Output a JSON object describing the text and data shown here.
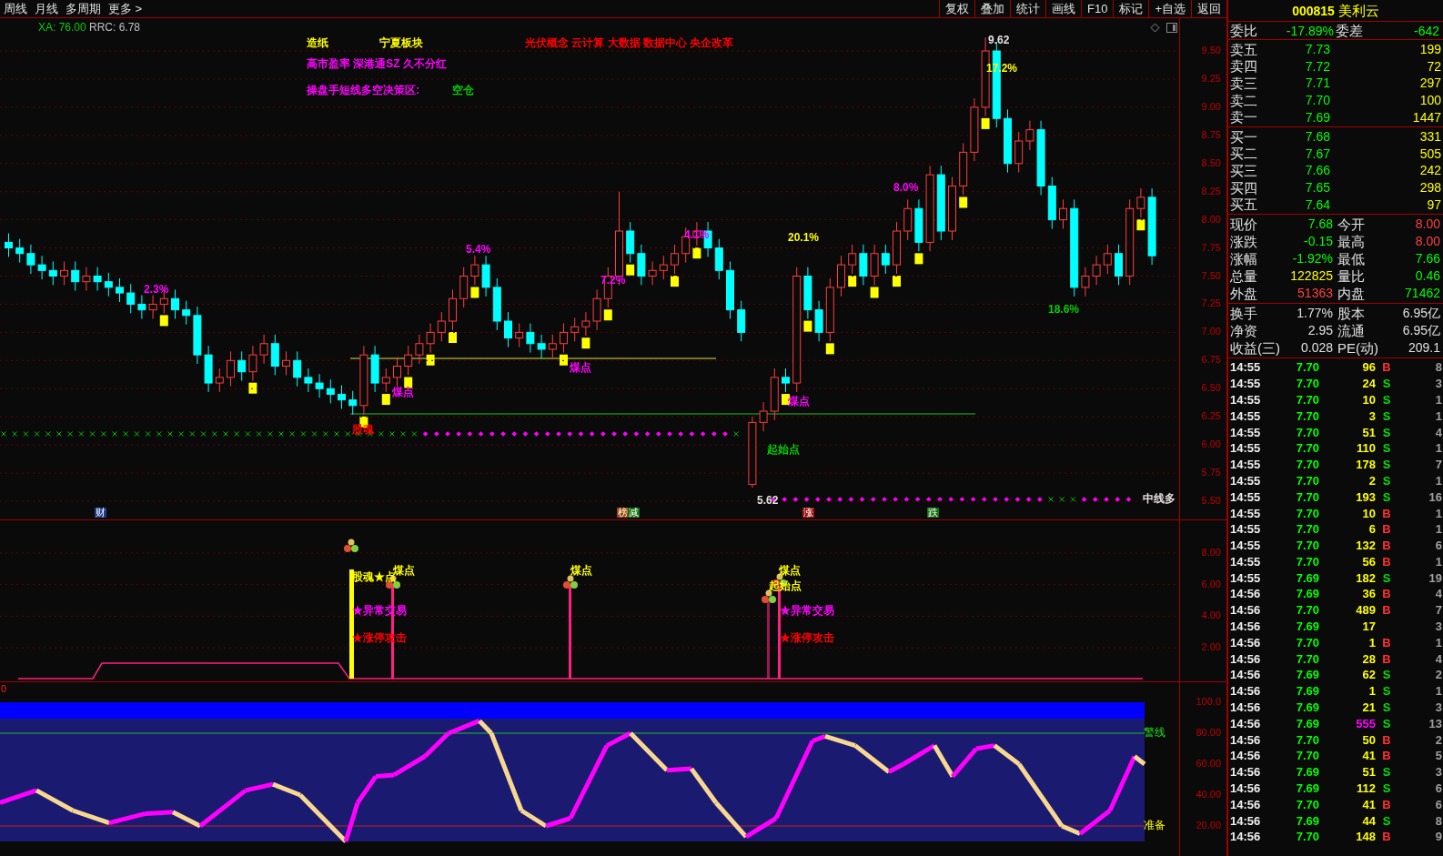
{
  "toolbar_left": [
    "周线",
    "月线",
    "多周期",
    "更多 >"
  ],
  "toolbar_right": [
    "复权",
    "叠加",
    "统计",
    "画线",
    "F10",
    "标记",
    "+自选",
    "返回"
  ],
  "main_chart": {
    "indicators": [
      {
        "text": "XA: 76.00",
        "color": "#00d000"
      },
      {
        "text": "RRC: 6.78",
        "color": "#c0c0c0"
      }
    ],
    "tags": [
      {
        "text": "造纸",
        "color": "#ffff00"
      },
      {
        "text": "宁夏板块",
        "color": "#ffff00"
      },
      {
        "text": "光伏概念 云计算 大数据 数据中心 央企改革",
        "color": "#ff0000"
      },
      {
        "text": "高市盈率 深港通SZ 久不分红",
        "color": "#ff00ff"
      },
      {
        "text": "操盘手短线多空决策区:",
        "color": "#ff00ff"
      },
      {
        "text": "空仓",
        "color": "#00d000"
      }
    ],
    "annotations": [
      {
        "text": "2.3%",
        "color": "#ff00ff"
      },
      {
        "text": "5.4%",
        "color": "#ff00ff"
      },
      {
        "text": "7.2%",
        "color": "#ff00ff"
      },
      {
        "text": "4.1%",
        "color": "#ff00ff"
      },
      {
        "text": "20.1%",
        "color": "#ffff00"
      },
      {
        "text": "8.0%",
        "color": "#ff00ff"
      },
      {
        "text": "17.2%",
        "color": "#ffff00"
      },
      {
        "text": "18.6%",
        "color": "#00d000"
      },
      {
        "text": "9.62",
        "color": "#e0e0e0"
      },
      {
        "text": "煤点",
        "color": "#ff00ff"
      },
      {
        "text": "煤点",
        "color": "#ff00ff"
      },
      {
        "text": "煤点",
        "color": "#ff00ff"
      },
      {
        "text": "起始点",
        "color": "#00d000"
      },
      {
        "text": "股魂",
        "color": "#ff0000"
      },
      {
        "text": "中线多",
        "color": "#e0e0e0"
      },
      {
        "text": "5.62",
        "color": "#e0e0e0"
      }
    ],
    "markers": [
      {
        "text": "财",
        "color": "#1a3a8a"
      },
      {
        "text": "榜",
        "color": "#a04000"
      },
      {
        "text": "减",
        "color": "#107010"
      },
      {
        "text": "涨",
        "color": "#a01010"
      },
      {
        "text": "跌",
        "color": "#107010"
      }
    ],
    "chart_data": {
      "type": "candlestick",
      "ohlc": [
        [
          7.8,
          7.88,
          7.67,
          7.75
        ],
        [
          7.75,
          7.83,
          7.62,
          7.7
        ],
        [
          7.7,
          7.78,
          7.52,
          7.6
        ],
        [
          7.6,
          7.68,
          7.47,
          7.55
        ],
        [
          7.55,
          7.63,
          7.42,
          7.5
        ],
        [
          7.5,
          7.63,
          7.42,
          7.55
        ],
        [
          7.55,
          7.63,
          7.37,
          7.45
        ],
        [
          7.45,
          7.58,
          7.37,
          7.5
        ],
        [
          7.5,
          7.58,
          7.37,
          7.45
        ],
        [
          7.45,
          7.53,
          7.32,
          7.4
        ],
        [
          7.4,
          7.48,
          7.27,
          7.35
        ],
        [
          7.35,
          7.43,
          7.17,
          7.25
        ],
        [
          7.25,
          7.33,
          7.12,
          7.2
        ],
        [
          7.2,
          7.33,
          7.12,
          7.25
        ],
        [
          7.25,
          7.38,
          7.17,
          7.3
        ],
        [
          7.3,
          7.38,
          7.12,
          7.2
        ],
        [
          7.2,
          7.28,
          7.07,
          7.15
        ],
        [
          7.15,
          7.23,
          6.72,
          6.8
        ],
        [
          6.8,
          6.88,
          6.47,
          6.55
        ],
        [
          6.55,
          6.68,
          6.47,
          6.6
        ],
        [
          6.6,
          6.83,
          6.52,
          6.75
        ],
        [
          6.75,
          6.83,
          6.57,
          6.65
        ],
        [
          6.65,
          6.88,
          6.57,
          6.8
        ],
        [
          6.8,
          6.98,
          6.72,
          6.9
        ],
        [
          6.9,
          6.98,
          6.62,
          6.7
        ],
        [
          6.7,
          6.83,
          6.62,
          6.75
        ],
        [
          6.75,
          6.83,
          6.52,
          6.6
        ],
        [
          6.6,
          6.68,
          6.47,
          6.55
        ],
        [
          6.55,
          6.63,
          6.42,
          6.5
        ],
        [
          6.5,
          6.58,
          6.37,
          6.45
        ],
        [
          6.45,
          6.53,
          6.32,
          6.4
        ],
        [
          6.4,
          6.48,
          6.27,
          6.35
        ],
        [
          6.35,
          6.88,
          6.27,
          6.8
        ],
        [
          6.8,
          6.88,
          6.47,
          6.55
        ],
        [
          6.55,
          6.68,
          6.47,
          6.6
        ],
        [
          6.6,
          6.78,
          6.52,
          6.7
        ],
        [
          6.7,
          6.88,
          6.62,
          6.8
        ],
        [
          6.8,
          6.98,
          6.72,
          6.9
        ],
        [
          6.9,
          7.08,
          6.82,
          7.0
        ],
        [
          7.0,
          7.18,
          6.92,
          7.1
        ],
        [
          7.1,
          7.38,
          7.02,
          7.3
        ],
        [
          7.3,
          7.58,
          7.22,
          7.5
        ],
        [
          7.5,
          7.68,
          7.42,
          7.6
        ],
        [
          7.6,
          7.68,
          7.32,
          7.4
        ],
        [
          7.4,
          7.48,
          7.02,
          7.1
        ],
        [
          7.1,
          7.18,
          6.87,
          6.95
        ],
        [
          6.95,
          7.08,
          6.87,
          7.0
        ],
        [
          7.0,
          7.08,
          6.82,
          6.9
        ],
        [
          6.9,
          6.98,
          6.77,
          6.85
        ],
        [
          6.85,
          6.98,
          6.77,
          6.9
        ],
        [
          6.9,
          7.08,
          6.82,
          7.0
        ],
        [
          7.0,
          7.13,
          6.92,
          7.05
        ],
        [
          7.05,
          7.18,
          6.97,
          7.1
        ],
        [
          7.1,
          7.38,
          7.02,
          7.3
        ],
        [
          7.3,
          7.58,
          7.22,
          7.5
        ],
        [
          7.5,
          8.25,
          7.42,
          7.9
        ],
        [
          7.9,
          7.98,
          7.62,
          7.7
        ],
        [
          7.7,
          7.78,
          7.42,
          7.5
        ],
        [
          7.5,
          7.63,
          7.42,
          7.55
        ],
        [
          7.55,
          7.68,
          7.47,
          7.6
        ],
        [
          7.6,
          7.78,
          7.52,
          7.7
        ],
        [
          7.7,
          7.93,
          7.62,
          7.85
        ],
        [
          7.85,
          7.98,
          7.77,
          7.9
        ],
        [
          7.9,
          7.98,
          7.67,
          7.75
        ],
        [
          7.75,
          7.83,
          7.47,
          7.55
        ],
        [
          7.55,
          7.63,
          7.12,
          7.2
        ],
        [
          7.2,
          7.28,
          6.92,
          7.0
        ],
        [
          5.65,
          6.25,
          5.62,
          6.2
        ],
        [
          6.2,
          6.38,
          6.12,
          6.3
        ],
        [
          6.3,
          6.68,
          6.22,
          6.6
        ],
        [
          6.6,
          6.68,
          6.47,
          6.55
        ],
        [
          6.55,
          7.58,
          6.47,
          7.5
        ],
        [
          7.5,
          7.58,
          7.12,
          7.2
        ],
        [
          7.2,
          7.28,
          6.92,
          7.0
        ],
        [
          7.0,
          7.48,
          6.92,
          7.4
        ],
        [
          7.4,
          7.68,
          7.32,
          7.6
        ],
        [
          7.6,
          7.78,
          7.52,
          7.7
        ],
        [
          7.7,
          7.78,
          7.42,
          7.5
        ],
        [
          7.5,
          7.78,
          7.42,
          7.7
        ],
        [
          7.7,
          7.78,
          7.52,
          7.6
        ],
        [
          7.6,
          7.98,
          7.52,
          7.9
        ],
        [
          7.9,
          8.18,
          7.82,
          8.1
        ],
        [
          8.1,
          8.18,
          7.72,
          7.8
        ],
        [
          7.8,
          8.48,
          7.72,
          8.4
        ],
        [
          8.4,
          8.48,
          7.82,
          7.9
        ],
        [
          7.9,
          8.38,
          7.82,
          8.3
        ],
        [
          8.3,
          8.68,
          8.22,
          8.6
        ],
        [
          8.6,
          9.08,
          8.52,
          9.0
        ],
        [
          9.0,
          9.62,
          8.92,
          9.5
        ],
        [
          9.5,
          9.58,
          8.82,
          8.9
        ],
        [
          8.9,
          8.98,
          8.42,
          8.5
        ],
        [
          8.5,
          8.78,
          8.42,
          8.7
        ],
        [
          8.7,
          8.88,
          8.62,
          8.8
        ],
        [
          8.8,
          8.88,
          8.22,
          8.3
        ],
        [
          8.3,
          8.38,
          7.92,
          8.0
        ],
        [
          8.0,
          8.18,
          7.92,
          8.1
        ],
        [
          8.1,
          8.18,
          7.32,
          7.4
        ],
        [
          7.4,
          7.58,
          7.32,
          7.5
        ],
        [
          7.5,
          7.68,
          7.42,
          7.6
        ],
        [
          7.6,
          7.78,
          7.52,
          7.7
        ],
        [
          7.7,
          7.78,
          7.42,
          7.5
        ],
        [
          7.5,
          8.18,
          7.42,
          8.1
        ],
        [
          8.1,
          8.28,
          8.02,
          8.2
        ],
        [
          8.2,
          8.28,
          7.6,
          7.68
        ]
      ],
      "ylim": [
        5.5,
        9.5
      ],
      "grid": true,
      "yticks": [
        {
          "value": 9.5,
          "label": "9.50"
        },
        {
          "value": 9.25,
          "label": "9.25"
        },
        {
          "value": 9.0,
          "label": "9.00"
        },
        {
          "value": 8.75,
          "label": "8.75"
        },
        {
          "value": 8.5,
          "label": "8.50"
        },
        {
          "value": 8.25,
          "label": "8.25"
        },
        {
          "value": 8.0,
          "label": "8.00"
        },
        {
          "value": 7.75,
          "label": "7.75"
        },
        {
          "value": 7.5,
          "label": "7.50"
        },
        {
          "value": 7.25,
          "label": "7.25"
        },
        {
          "value": 7.0,
          "label": "7.00"
        },
        {
          "value": 6.75,
          "label": "6.75"
        },
        {
          "value": 6.5,
          "label": "6.50"
        },
        {
          "value": 6.25,
          "label": "6.25"
        },
        {
          "value": 6.0,
          "label": "6.00"
        },
        {
          "value": 5.75,
          "label": "5.75"
        },
        {
          "value": 5.5,
          "label": "5.50"
        }
      ]
    }
  },
  "signal_panel": {
    "labels": [
      {
        "text": "股魂",
        "color": "#ffff00"
      },
      {
        "text": "★点",
        "color": "#ffff00"
      },
      {
        "text": "煤点",
        "color": "#ffff00"
      },
      {
        "text": "煤点",
        "color": "#ffff00"
      },
      {
        "text": "煤点",
        "color": "#ffff00"
      },
      {
        "text": "起始点",
        "color": "#ffff00"
      },
      {
        "text": "★异常交易",
        "color": "#ff00ff"
      },
      {
        "text": "★异常交易",
        "color": "#ff00ff"
      },
      {
        "text": "★涨停攻击",
        "color": "#ff0000"
      },
      {
        "text": "★涨停攻击",
        "color": "#ff0000"
      }
    ],
    "axis": [
      "8.00",
      "6.00",
      "4.00",
      "2.00"
    ]
  },
  "oscillator_panel": {
    "zero_label": "0",
    "upper_label": "警线",
    "lower_label": "准备",
    "axis": [
      "100.0",
      "80.00",
      "60.00",
      "40.00",
      "20.00"
    ]
  },
  "quote": {
    "code": "000815",
    "name": "美利云",
    "ratio": [
      {
        "label": "委比",
        "value": "-17.89%",
        "color": "#00ff00"
      },
      {
        "label": "委差",
        "value": "-642",
        "color": "#00ff00"
      }
    ],
    "asks": [
      {
        "label": "卖五",
        "price": "7.73",
        "volume": "199"
      },
      {
        "label": "卖四",
        "price": "7.72",
        "volume": "72"
      },
      {
        "label": "卖三",
        "price": "7.71",
        "volume": "297"
      },
      {
        "label": "卖二",
        "price": "7.70",
        "volume": "100"
      },
      {
        "label": "卖一",
        "price": "7.69",
        "volume": "1447"
      }
    ],
    "bids": [
      {
        "label": "买一",
        "price": "7.68",
        "volume": "331"
      },
      {
        "label": "买二",
        "price": "7.67",
        "volume": "505"
      },
      {
        "label": "买三",
        "price": "7.66",
        "volume": "242"
      },
      {
        "label": "买四",
        "price": "7.65",
        "volume": "298"
      },
      {
        "label": "买五",
        "price": "7.64",
        "volume": "97"
      }
    ],
    "stats": [
      {
        "label": "现价",
        "value": "7.68",
        "color": "#00ff00"
      },
      {
        "label": "今开",
        "value": "8.00",
        "color": "#ff4040"
      },
      {
        "label": "涨跌",
        "value": "-0.15",
        "color": "#00ff00"
      },
      {
        "label": "最高",
        "value": "8.00",
        "color": "#ff4040"
      },
      {
        "label": "涨幅",
        "value": "-1.92%",
        "color": "#00ff00"
      },
      {
        "label": "最低",
        "value": "7.66",
        "color": "#00ff00"
      },
      {
        "label": "总量",
        "value": "122825",
        "color": "#ffff00"
      },
      {
        "label": "量比",
        "value": "0.46",
        "color": "#00ff00"
      },
      {
        "label": "外盘",
        "value": "51363",
        "color": "#ff4040"
      },
      {
        "label": "内盘",
        "value": "71462",
        "color": "#00ff00"
      }
    ],
    "fundamentals": [
      {
        "label": "换手",
        "value": "1.77%"
      },
      {
        "label": "股本",
        "value": "6.95亿"
      },
      {
        "label": "净资",
        "value": "2.95"
      },
      {
        "label": "流通",
        "value": "6.95亿"
      },
      {
        "label": "收益(三)",
        "value": "0.028"
      },
      {
        "label": "PE(动)",
        "value": "209.1"
      }
    ]
  },
  "trades": [
    {
      "time": "14:55",
      "price": "7.70",
      "volume": "96",
      "side": "B",
      "buy": true,
      "large": false,
      "count": "8"
    },
    {
      "time": "14:55",
      "price": "7.70",
      "volume": "24",
      "side": "S",
      "buy": false,
      "large": false,
      "count": "3"
    },
    {
      "time": "14:55",
      "price": "7.70",
      "volume": "10",
      "side": "S",
      "buy": false,
      "large": false,
      "count": "1"
    },
    {
      "time": "14:55",
      "price": "7.70",
      "volume": "3",
      "side": "S",
      "buy": false,
      "large": false,
      "count": "1"
    },
    {
      "time": "14:55",
      "price": "7.70",
      "volume": "51",
      "side": "S",
      "buy": false,
      "large": false,
      "count": "4"
    },
    {
      "time": "14:55",
      "price": "7.70",
      "volume": "110",
      "side": "S",
      "buy": false,
      "large": false,
      "count": "1"
    },
    {
      "time": "14:55",
      "price": "7.70",
      "volume": "178",
      "side": "S",
      "buy": false,
      "large": false,
      "count": "7"
    },
    {
      "time": "14:55",
      "price": "7.70",
      "volume": "2",
      "side": "S",
      "buy": false,
      "large": false,
      "count": "1"
    },
    {
      "time": "14:55",
      "price": "7.70",
      "volume": "193",
      "side": "S",
      "buy": false,
      "large": false,
      "count": "16"
    },
    {
      "time": "14:55",
      "price": "7.70",
      "volume": "10",
      "side": "B",
      "buy": true,
      "large": false,
      "count": "1"
    },
    {
      "time": "14:55",
      "price": "7.70",
      "volume": "6",
      "side": "B",
      "buy": true,
      "large": false,
      "count": "1"
    },
    {
      "time": "14:55",
      "price": "7.70",
      "volume": "132",
      "side": "B",
      "buy": true,
      "large": false,
      "count": "6"
    },
    {
      "time": "14:55",
      "price": "7.70",
      "volume": "56",
      "side": "B",
      "buy": true,
      "large": false,
      "count": "1"
    },
    {
      "time": "14:55",
      "price": "7.69",
      "volume": "182",
      "side": "S",
      "buy": false,
      "large": false,
      "count": "19"
    },
    {
      "time": "14:56",
      "price": "7.69",
      "volume": "36",
      "side": "B",
      "buy": true,
      "large": false,
      "count": "4"
    },
    {
      "time": "14:56",
      "price": "7.70",
      "volume": "489",
      "side": "B",
      "buy": true,
      "large": false,
      "count": "7"
    },
    {
      "time": "14:56",
      "price": "7.69",
      "volume": "17",
      "large": false,
      "count": "3"
    },
    {
      "time": "14:56",
      "price": "7.70",
      "volume": "1",
      "side": "B",
      "buy": true,
      "large": false,
      "count": "1"
    },
    {
      "time": "14:56",
      "price": "7.70",
      "volume": "28",
      "side": "B",
      "buy": true,
      "large": false,
      "count": "4"
    },
    {
      "time": "14:56",
      "price": "7.69",
      "volume": "62",
      "side": "S",
      "buy": false,
      "large": false,
      "count": "2"
    },
    {
      "time": "14:56",
      "price": "7.69",
      "volume": "1",
      "side": "S",
      "buy": false,
      "large": false,
      "count": "1"
    },
    {
      "time": "14:56",
      "price": "7.69",
      "volume": "21",
      "side": "S",
      "buy": false,
      "large": false,
      "count": "3"
    },
    {
      "time": "14:56",
      "price": "7.69",
      "volume": "555",
      "side": "S",
      "buy": false,
      "large": true,
      "count": "13"
    },
    {
      "time": "14:56",
      "price": "7.70",
      "volume": "50",
      "side": "B",
      "buy": true,
      "large": false,
      "count": "2"
    },
    {
      "time": "14:56",
      "price": "7.70",
      "volume": "41",
      "side": "B",
      "buy": true,
      "large": false,
      "count": "5"
    },
    {
      "time": "14:56",
      "price": "7.69",
      "volume": "51",
      "side": "S",
      "buy": false,
      "large": false,
      "count": "3"
    },
    {
      "time": "14:56",
      "price": "7.69",
      "volume": "112",
      "side": "S",
      "buy": false,
      "large": false,
      "count": "6"
    },
    {
      "time": "14:56",
      "price": "7.70",
      "volume": "41",
      "side": "B",
      "buy": true,
      "large": false,
      "count": "6"
    },
    {
      "time": "14:56",
      "price": "7.69",
      "volume": "44",
      "side": "S",
      "buy": false,
      "large": false,
      "count": "8"
    },
    {
      "time": "14:56",
      "price": "7.70",
      "volume": "148",
      "side": "B",
      "buy": true,
      "large": false,
      "count": "9"
    }
  ]
}
